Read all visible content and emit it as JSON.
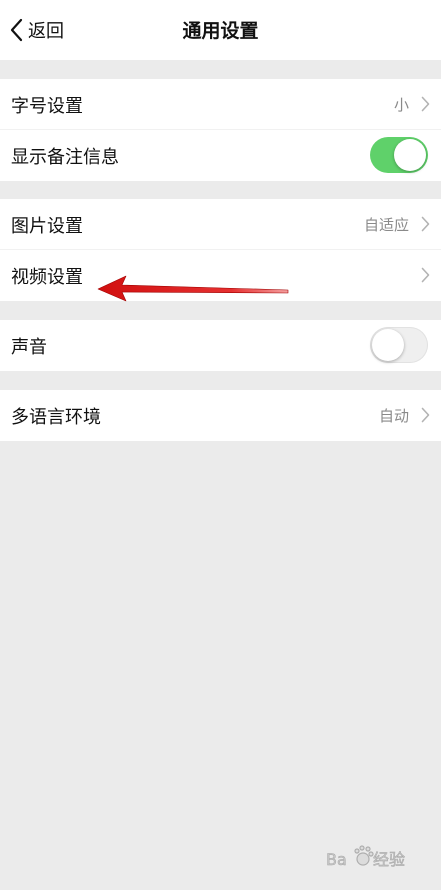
{
  "header": {
    "back_label": "返回",
    "title": "通用设置"
  },
  "groups": [
    {
      "rows": [
        {
          "label": "字号设置",
          "value": "小"
        },
        {
          "label": "显示备注信息"
        }
      ]
    },
    {
      "rows": [
        {
          "label": "图片设置",
          "value": "自适应"
        },
        {
          "label": "视频设置"
        }
      ]
    },
    {
      "rows": [
        {
          "label": "声音"
        }
      ]
    },
    {
      "rows": [
        {
          "label": "多语言环境",
          "value": "自动"
        }
      ]
    }
  ],
  "toggles": {
    "show_remark_info": true,
    "sound": false
  },
  "colors": {
    "background": "#ebebeb",
    "toggle_on": "#5fd16a",
    "annotation_arrow": "#e01b1b"
  },
  "watermark": {
    "text": "Baidu经验"
  }
}
